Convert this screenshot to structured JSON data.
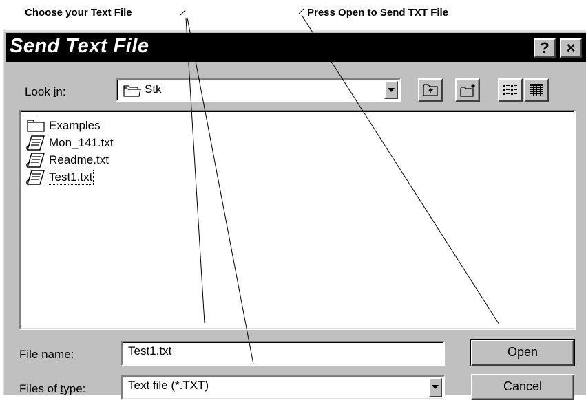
{
  "callouts": {
    "choose": "Choose your Text File",
    "press": "Press Open to Send TXT File"
  },
  "dialog": {
    "title": "Send Text File",
    "help_glyph": "?",
    "close_glyph": "×"
  },
  "look_in": {
    "label_pre": "Look ",
    "label_accel": "i",
    "label_post": "n:",
    "value": "Stk"
  },
  "toolbar": {
    "icons": [
      "up-one-level-icon",
      "new-folder-icon",
      "list-view-icon",
      "details-view-icon"
    ]
  },
  "files": [
    {
      "name": "Examples",
      "type": "folder"
    },
    {
      "name": "Mon_141.txt",
      "type": "text"
    },
    {
      "name": "Readme.txt",
      "type": "text"
    },
    {
      "name": "Test1.txt",
      "type": "text",
      "focused": true
    }
  ],
  "file_name": {
    "label_pre": "File ",
    "label_accel": "n",
    "label_post": "ame:",
    "value": "Test1.txt"
  },
  "file_type": {
    "label_pre": "Files of ",
    "label_accel": "t",
    "label_post": "ype:",
    "value": "Text file (*.TXT)"
  },
  "buttons": {
    "open_accel": "O",
    "open_rest": "pen",
    "cancel": "Cancel"
  }
}
